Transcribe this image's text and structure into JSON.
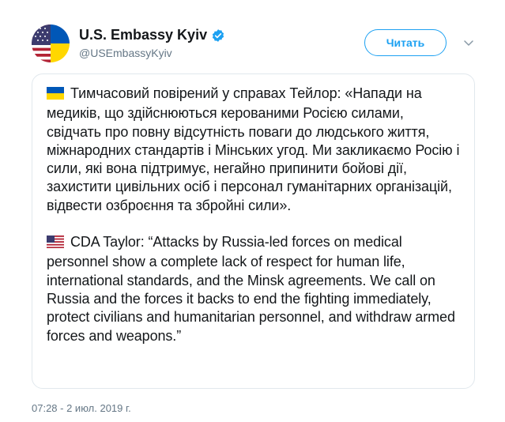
{
  "author": {
    "display_name": "U.S. Embassy Kyiv",
    "handle": "@USEmbassyKyiv",
    "avatar_icon": "us-ukraine-flag-avatar",
    "verified_icon": "verified-badge-icon"
  },
  "follow_button": {
    "label": "Читать"
  },
  "menu": {
    "icon": "chevron-down-icon"
  },
  "tweet": {
    "paragraphs": [
      {
        "flag_icon": "ukraine-flag-icon",
        "text": "Тимчасовий повірений у справах Тейлор: «Напади на медиків, що здійснюються керованими Росією силами, свідчать про повну відсутність поваги до людського життя, міжнародних стандартів і Мінських угод. Ми закликаємо Росію і сили, які вона підтримує, негайно припинити бойові дії, захистити цивільних осіб і персонал гуманітарних організацій, відвести озброєння та збройні сили»."
      },
      {
        "flag_icon": "us-flag-icon",
        "text": "CDA Taylor: “Attacks by Russia-led forces on medical personnel show a complete lack of respect for human life, international standards, and the Minsk agreements. We call on Russia and the forces it backs to end the fighting immediately, protect civilians and humanitarian personnel, and withdraw armed forces and weapons.”"
      }
    ]
  },
  "timestamp": "07:28 - 2 июл. 2019 г.",
  "colors": {
    "accent": "#1da1f2",
    "text_primary": "#14171a",
    "text_secondary": "#657786",
    "border": "#e1e8ed"
  }
}
